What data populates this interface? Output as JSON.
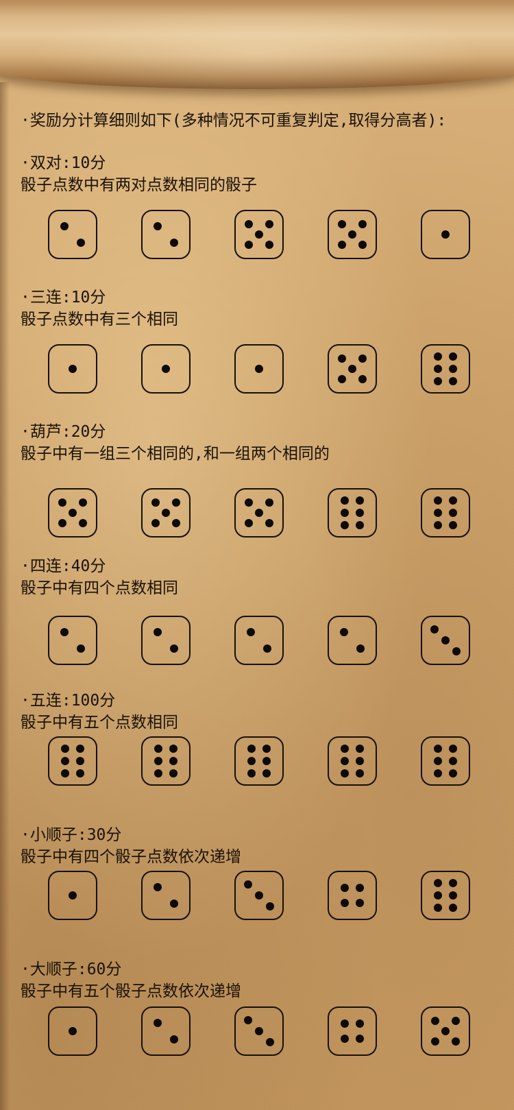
{
  "intro": "·奖励分计算细则如下(多种情况不可重复判定,取得分高者):",
  "sections": [
    {
      "title": "·双对:10分",
      "desc": "骰子点数中有两对点数相同的骰子",
      "dice": [
        2,
        2,
        5,
        5,
        1
      ]
    },
    {
      "title": "·三连:10分",
      "desc": "骰子点数中有三个相同",
      "dice": [
        1,
        1,
        1,
        5,
        6
      ]
    },
    {
      "title": "·葫芦:20分",
      "desc": "骰子中有一组三个相同的,和一组两个相同的",
      "dice": [
        5,
        5,
        5,
        6,
        6
      ]
    },
    {
      "title": "·四连:40分",
      "desc": "骰子中有四个点数相同",
      "dice": [
        2,
        2,
        2,
        2,
        3
      ]
    },
    {
      "title": "·五连:100分",
      "desc": "骰子中有五个点数相同",
      "dice": [
        6,
        6,
        6,
        6,
        6
      ]
    },
    {
      "title": "·小顺子:30分",
      "desc": "骰子中有四个骰子点数依次递增",
      "dice": [
        1,
        2,
        3,
        4,
        6
      ]
    },
    {
      "title": "·大顺子:60分",
      "desc": "骰子中有五个骰子点数依次递增",
      "dice": [
        1,
        2,
        3,
        4,
        5
      ]
    }
  ],
  "colors": {
    "parchment": "#cfa56b",
    "ink": "#1a120a"
  },
  "icons": {
    "die": "die-face-icon"
  }
}
